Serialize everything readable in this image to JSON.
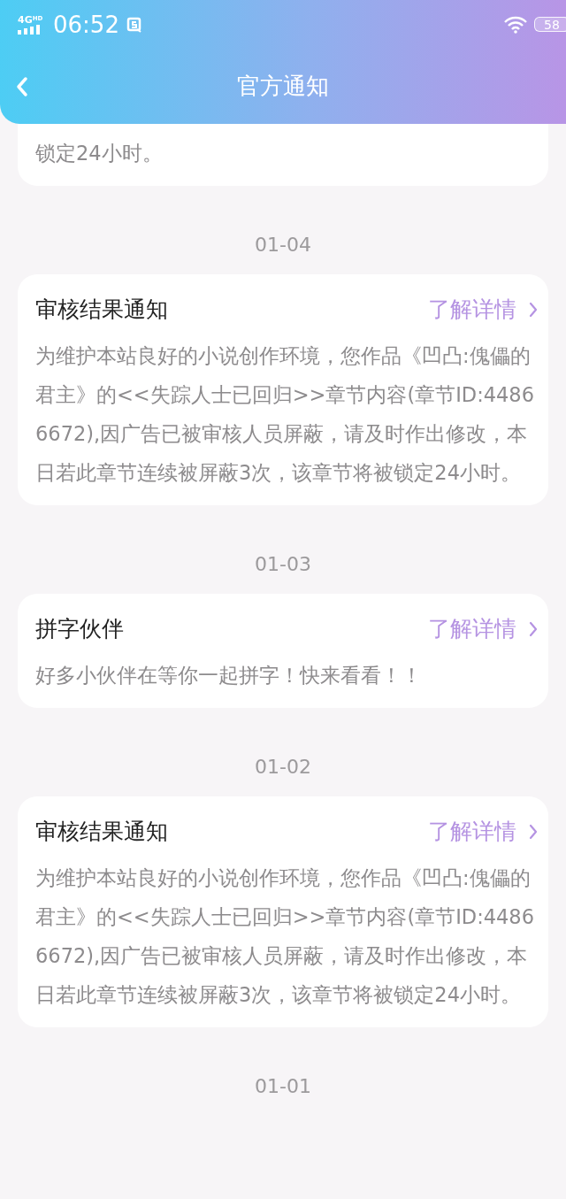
{
  "status_bar": {
    "network": "4G",
    "network_extra": "HD",
    "time": "06:52",
    "battery": "58"
  },
  "header": {
    "title": "官方通知"
  },
  "notices": [
    {
      "kind": "continued",
      "body": "锁定24小时。"
    },
    {
      "kind": "notice",
      "date": "01-04",
      "title": "审核结果通知",
      "link": "了解详情",
      "body": "为维护本站良好的小说创作环境，您作品《凹凸:傀儡的君主》的<<失踪人士已回归>>章节内容(章节ID:44866672),因广告已被审核人员屏蔽，请及时作出修改，本日若此章节连续被屏蔽3次，该章节将被锁定24小时。"
    },
    {
      "kind": "notice",
      "date": "01-03",
      "title": "拼字伙伴",
      "link": "了解详情",
      "body": "好多小伙伴在等你一起拼字！快来看看！！"
    },
    {
      "kind": "notice",
      "date": "01-02",
      "title": "审核结果通知",
      "link": "了解详情",
      "body": "为维护本站良好的小说创作环境，您作品《凹凸:傀儡的君主》的<<失踪人士已回归>>章节内容(章节ID:44866672),因广告已被审核人员屏蔽，请及时作出修改，本日若此章节连续被屏蔽3次，该章节将被锁定24小时。"
    },
    {
      "kind": "date_only",
      "date": "01-01"
    }
  ]
}
